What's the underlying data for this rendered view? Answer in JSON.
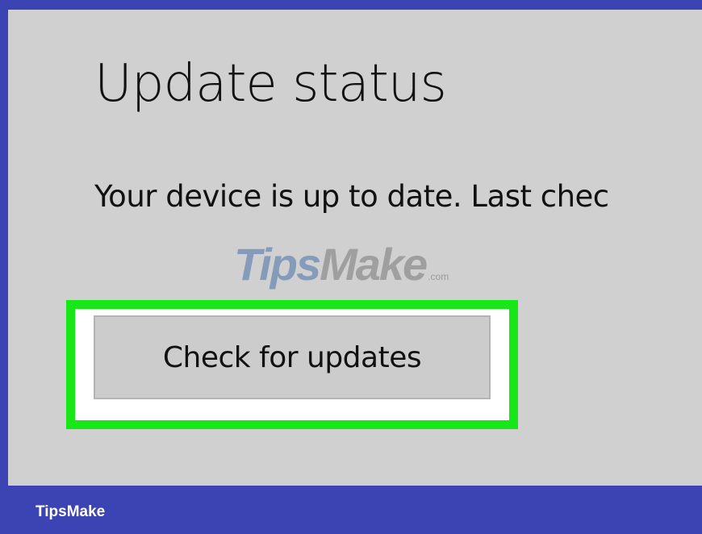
{
  "colors": {
    "frame": "#3c43b3",
    "panel": "#d0d0d0",
    "highlight": "#17e617",
    "button": "#cccccc",
    "text": "#111111"
  },
  "update": {
    "title": "Update status",
    "status": "Your device is up to date. Last chec",
    "check_button_label": "Check for updates"
  },
  "watermark": {
    "part1": "Tips",
    "part2": "Make",
    "suffix": ".com"
  },
  "footer": {
    "brand": "TipsMake"
  }
}
